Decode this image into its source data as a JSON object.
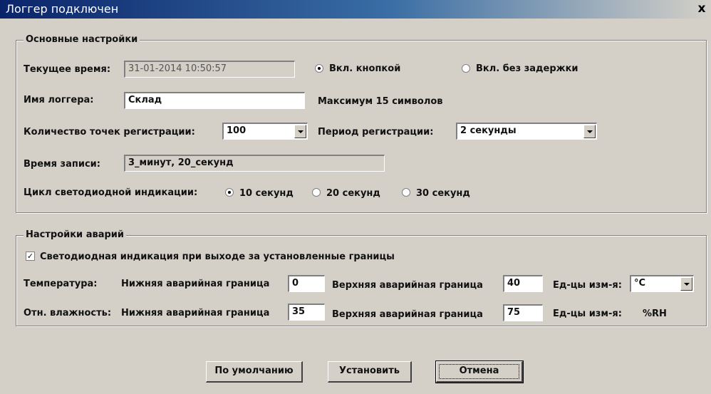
{
  "window": {
    "title": "Логгер подключен",
    "close_glyph": "x"
  },
  "basic": {
    "legend": "Основные настройки",
    "current_time_label": "Текущее время:",
    "current_time_value": "31-01-2014 10:50:57",
    "start_options": [
      "Вкл. кнопкой",
      "Вкл. без задержки"
    ],
    "start_selected": 0,
    "logger_name_label": "Имя логгера:",
    "logger_name_value": "Склад",
    "logger_name_hint": "Максимум 15 символов",
    "points_label": "Количество точек регистрации:",
    "points_value": "100",
    "period_label": "Период регистрации:",
    "period_value": "2 секунды",
    "record_time_label": "Время записи:",
    "record_time_value": "3_минут, 20_секунд",
    "led_cycle_label": "Цикл светодиодной индикации:",
    "led_cycle_options": [
      "10 секунд",
      "20 секунд",
      "30 секунд"
    ],
    "led_cycle_selected": 0
  },
  "alarms": {
    "legend": "Настройки аварий",
    "led_alarm_label": "Светодиодная индикация при выходе за установленные границы",
    "led_alarm_checked": true,
    "check_glyph": "✓",
    "temp_label": "Температура:",
    "temp_low_label": "Нижняя аварийная граница",
    "temp_low_value": "0",
    "temp_high_label": "Верхняя аварийная граница",
    "temp_high_value": "40",
    "temp_unit_label": "Ед-цы изм-я:",
    "temp_unit_value": "°C",
    "hum_label": "Отн. влажность:",
    "hum_low_label": "Нижняя аварийная граница",
    "hum_low_value": "35",
    "hum_high_label": "Верхняя аварийная граница",
    "hum_high_value": "75",
    "hum_unit_label": "Ед-цы изм-я:",
    "hum_unit_value": "%RH"
  },
  "buttons": {
    "defaults": "По умолчанию",
    "apply": "Установить",
    "cancel": "Отмена"
  }
}
